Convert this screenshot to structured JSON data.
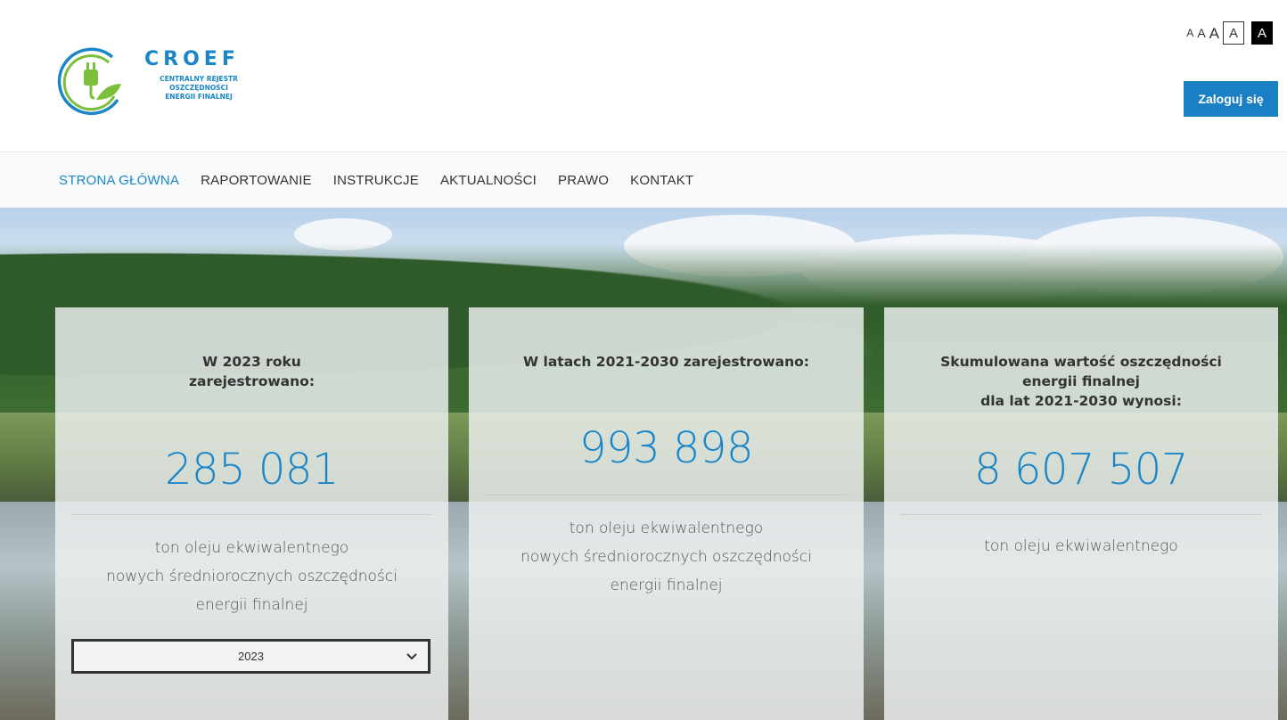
{
  "header": {
    "logo": {
      "title": "CROEF",
      "subtitle_lines": [
        "CENTRALNY REJESTR",
        "OSZCZĘDNOŚCI",
        "ENERGII FINALNEJ"
      ],
      "icon": "plug-leaf-icon"
    },
    "font_sizes": [
      "A",
      "A",
      "A",
      "A",
      "A"
    ],
    "login_label": "Zaloguj się"
  },
  "nav": {
    "items": [
      {
        "label": "STRONA GŁÓWNA",
        "active": true
      },
      {
        "label": "RAPORTOWANIE",
        "active": false
      },
      {
        "label": "INSTRUKCJE",
        "active": false
      },
      {
        "label": "AKTUALNOŚCI",
        "active": false
      },
      {
        "label": "PRAWO",
        "active": false
      },
      {
        "label": "KONTAKT",
        "active": false
      }
    ]
  },
  "cards": [
    {
      "heading_lines": [
        "W 2023 roku",
        "zarejestrowano:"
      ],
      "value": "285 081",
      "desc_lines": [
        "ton oleju ekwiwalentnego",
        "nowych średniorocznych oszczędności",
        "energii finalnej"
      ],
      "select": {
        "value": "2023",
        "icon": "chevron-down-icon"
      }
    },
    {
      "heading_lines": [
        "W latach 2021-2030 zarejestrowano:"
      ],
      "value": "993 898",
      "desc_lines": [
        "ton oleju ekwiwalentnego",
        "nowych średniorocznych oszczędności",
        "energii finalnej"
      ]
    },
    {
      "heading_lines": [
        "Skumulowana wartość oszczędności",
        "energii finalnej",
        "dla lat 2021-2030 wynosi:"
      ],
      "value": "8 607 507",
      "desc_lines": [
        "ton oleju ekwiwalentnego"
      ]
    }
  ],
  "colors": {
    "accent": "#1a86c8",
    "login_button": "#1b7fc4",
    "nav_background": "#f9fafb",
    "logo_green": "#7bbf3a"
  }
}
